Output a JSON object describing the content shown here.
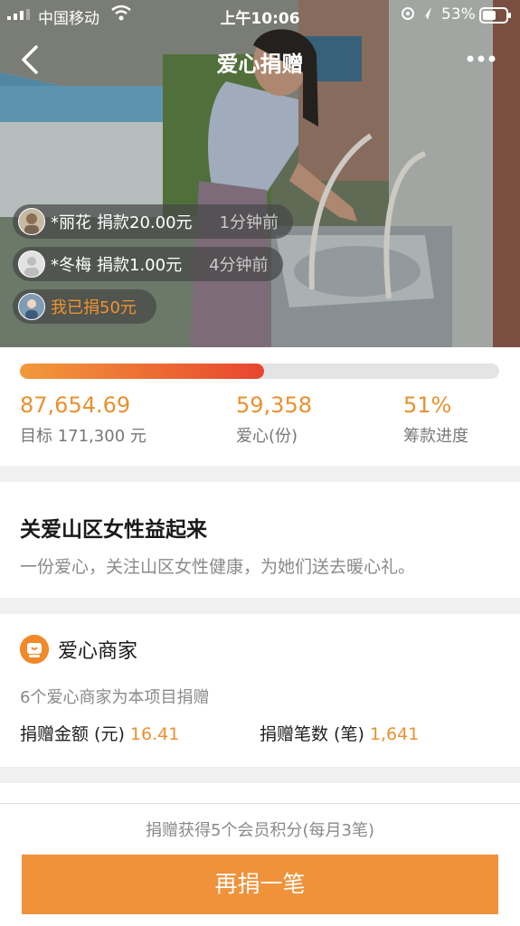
{
  "status_bar": {
    "carrier": "中国移动",
    "time": "上午10:06",
    "battery": "53%"
  },
  "nav": {
    "title": "爱心捐赠"
  },
  "ticker": [
    {
      "name": "*丽花",
      "amount": "捐款20.00元",
      "ago": "1分钟前"
    },
    {
      "name": "*冬梅",
      "amount": "捐款1.00元",
      "ago": "4分钟前"
    }
  ],
  "my_donation": "我已捐50元",
  "progress": {
    "raised": "87,654.69",
    "goal_label": "目标 171,300 元",
    "hearts": "59,358",
    "hearts_label": "爱心(份)",
    "percent": "51%",
    "percent_label": "筹款进度",
    "fraction": 0.51
  },
  "project": {
    "title": "关爱山区女性益起来",
    "desc": "一份爱心，关注山区女性健康，为她们送去暖心礼。"
  },
  "merchants": {
    "title": "爱心商家",
    "subtitle": "6个爱心商家为本项目捐赠",
    "amount_label": "捐赠金额 (元)",
    "amount": "16.41",
    "count_label": "捐赠笔数 (笔)",
    "count": "1,641"
  },
  "footer": {
    "points_note": "捐赠获得5个会员积分(每月3笔)",
    "button": "再捐一笔"
  },
  "colors": {
    "accent": "#f0923a",
    "progress_start": "#f19a3a",
    "progress_end": "#e8452f"
  }
}
